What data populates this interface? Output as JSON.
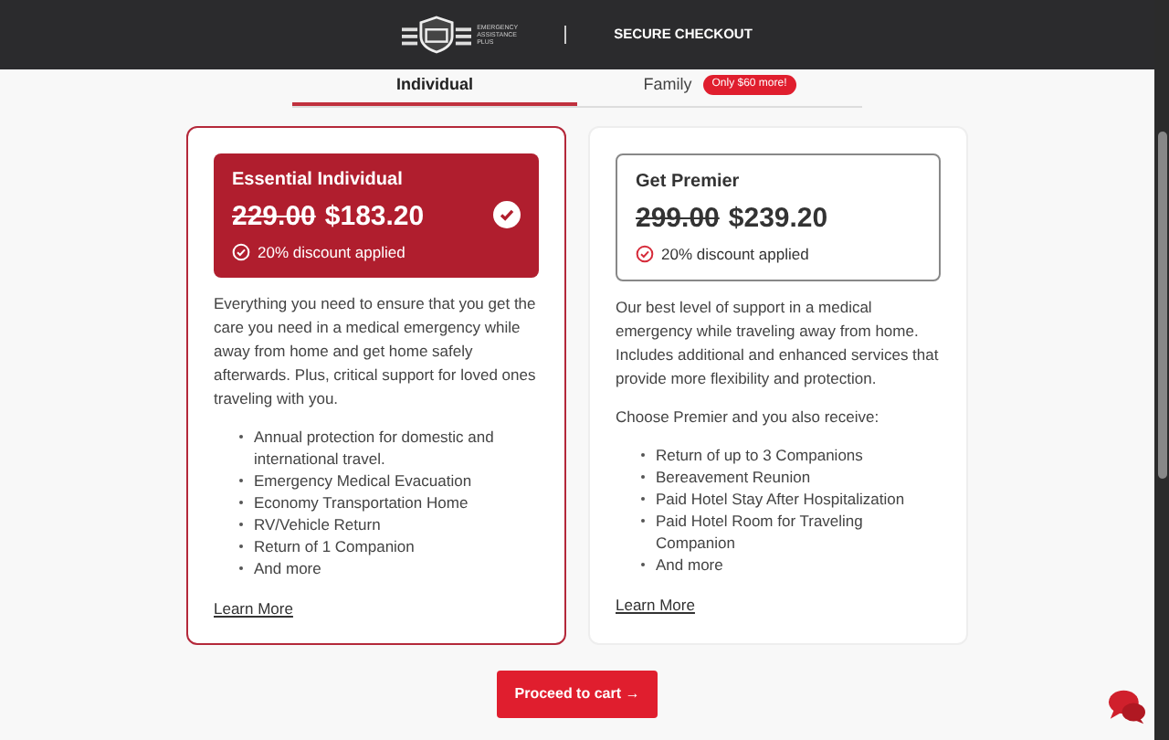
{
  "header": {
    "logo_text": "EMERGENCY ASSISTANCE PLUS",
    "title": "SECURE CHECKOUT"
  },
  "tabs": [
    {
      "label": "Individual",
      "selected": true
    },
    {
      "label": "Family",
      "selected": false,
      "badge": "Only $60 more!"
    }
  ],
  "plans": [
    {
      "name": "Essential Individual",
      "old_price": "229.00",
      "price": "$183.20",
      "discount": "20% discount applied",
      "selected": true,
      "paragraphs": [
        "Everything you need to ensure that you get the care you need in a medical emergency while away from home and get home safely afterwards. Plus, critical support for loved ones traveling with you."
      ],
      "features": [
        "Annual protection for domestic and international travel.",
        "Emergency Medical Evacuation",
        "Economy Transportation Home",
        "RV/Vehicle Return",
        "Return of 1 Companion",
        "And more"
      ],
      "link": "Learn More"
    },
    {
      "name": "Get Premier",
      "old_price": "299.00",
      "price": "$239.20",
      "discount": "20% discount applied",
      "selected": false,
      "paragraphs": [
        "Our best level of support in a medical emergency while traveling away from home. Includes additional and enhanced services that provide more flexibility and protection.",
        "Choose Premier and you also receive:"
      ],
      "features": [
        "Return of up to 3 Companions",
        "Bereavement Reunion",
        "Paid Hotel Stay After Hospitalization",
        "Paid Hotel Room for Traveling Companion",
        "And more"
      ],
      "link": "Learn More"
    }
  ],
  "proceed_button": "Proceed to cart →"
}
